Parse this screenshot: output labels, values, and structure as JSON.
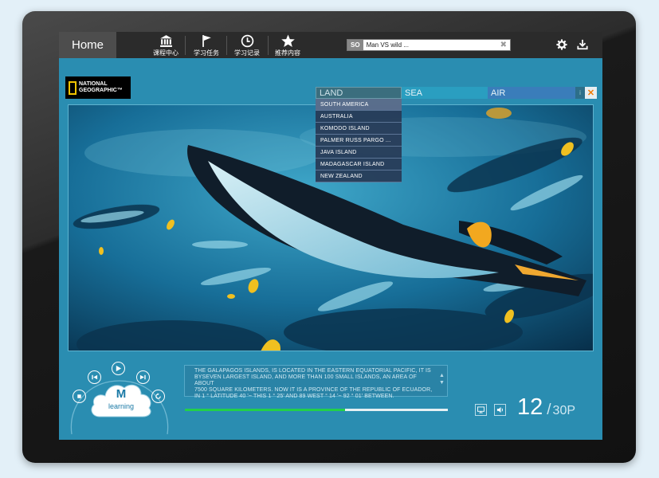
{
  "nav": {
    "home": "Home",
    "items": [
      {
        "label": "课程中心",
        "icon": "building-icon"
      },
      {
        "label": "学习任务",
        "icon": "flag-icon"
      },
      {
        "label": "学习记录",
        "icon": "clock-icon"
      },
      {
        "label": "推荐内容",
        "icon": "star-icon"
      }
    ],
    "search_prefix": "SO",
    "search_value": "Man VS wild ...",
    "settings_icon": "gear-icon",
    "download_icon": "download-icon"
  },
  "logo": {
    "line1": "NATIONAL",
    "line2": "GEOGRAPHIC™"
  },
  "categories": {
    "tabs": [
      "LAND",
      "SEA",
      "AIR"
    ],
    "info_icon": "i",
    "close_icon": "close-icon",
    "dropdown": [
      "SOUTH AMERICA",
      "AUSTRALIA",
      "KOMODO ISLAND",
      "PALMER RUSS PARGO ...",
      "JAVA ISLAND",
      "MADAGASCAR ISLAND",
      "NEW ZEALAND"
    ]
  },
  "description": {
    "line1": "THE GALAPAGOS ISLANDS, IS LOCATED IN THE EASTERN EQUATORIAL PACIFIC, IT IS",
    "line2": "BYSEVEN LARGEST ISLAND, AND MORE THAN 100 SMALL ISLANDS, AN AREA OF ABOUT",
    "line3": "7500 SQUARE KILOMETERS. NOW IT IS A PROVINCE OF THE REPUBLIC OF ECUADOR,",
    "line4": "IN 1 ° LATITUDE 40 '~ THIS 1 ° 25' AND 89 WEST ° 14 '~ 92 ° 01' BETWEEN."
  },
  "player": {
    "cloud_letter": "M",
    "cloud_label": "learning",
    "progress": 0.61,
    "page_current": "12",
    "page_total": "30P"
  },
  "colors": {
    "accent": "#2a8db1",
    "progress": "#22d04a",
    "close": "#f07a00"
  }
}
